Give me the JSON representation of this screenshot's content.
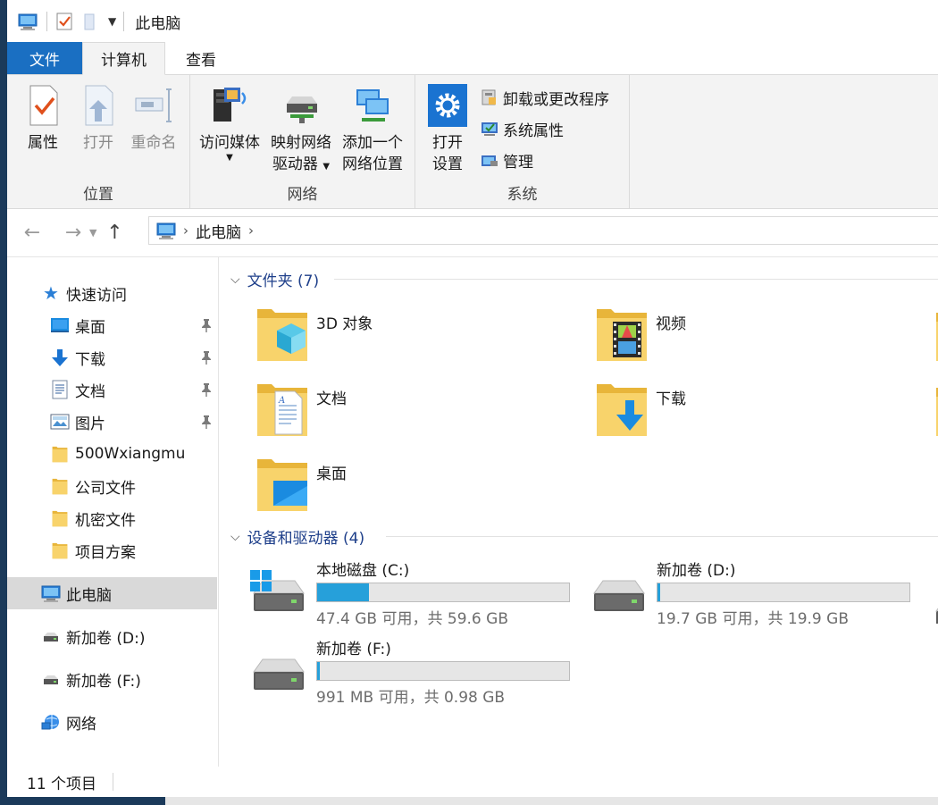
{
  "window": {
    "title": "此电脑"
  },
  "tabs": {
    "file": "文件",
    "computer": "计算机",
    "view": "查看"
  },
  "ribbon": {
    "location": {
      "label": "位置",
      "properties": "属性",
      "open": "打开",
      "rename": "重命名"
    },
    "network": {
      "label": "网络",
      "access_media": "访问媒体",
      "map_drive_1": "映射网络",
      "map_drive_2": "驱动器",
      "add_location_1": "添加一个",
      "add_location_2": "网络位置"
    },
    "system": {
      "label": "系统",
      "open_settings_1": "打开",
      "open_settings_2": "设置",
      "uninstall": "卸载或更改程序",
      "system_properties": "系统属性",
      "manage": "管理"
    }
  },
  "address": {
    "crumb": "此电脑"
  },
  "nav": {
    "quick_access": "快速访问",
    "items": [
      {
        "label": "桌面",
        "pinned": true
      },
      {
        "label": "下载",
        "pinned": true
      },
      {
        "label": "文档",
        "pinned": true
      },
      {
        "label": "图片",
        "pinned": true
      },
      {
        "label": "500Wxiangmu",
        "pinned": false
      },
      {
        "label": "公司文件",
        "pinned": false
      },
      {
        "label": "机密文件",
        "pinned": false
      },
      {
        "label": "项目方案",
        "pinned": false
      }
    ],
    "this_pc": "此电脑",
    "drive_d": "新加卷 (D:)",
    "drive_f": "新加卷 (F:)",
    "network": "网络"
  },
  "content": {
    "folders_header": "文件夹 (7)",
    "folders": [
      {
        "name": "3D 对象",
        "icon": "3d-objects-icon"
      },
      {
        "name": "视频",
        "icon": "videos-icon"
      },
      {
        "name": "文档",
        "icon": "documents-icon"
      },
      {
        "name": "下载",
        "icon": "downloads-icon"
      },
      {
        "name": "桌面",
        "icon": "desktop-icon"
      }
    ],
    "drives_header": "设备和驱动器 (4)",
    "drives": [
      {
        "name": "本地磁盘 (C:)",
        "free": "47.4 GB 可用，共 59.6 GB",
        "used_fraction": 0.205,
        "system": true
      },
      {
        "name": "新加卷 (D:)",
        "free": "19.7 GB 可用，共 19.9 GB",
        "used_fraction": 0.01,
        "system": false
      },
      {
        "name": "新加卷 (F:)",
        "free": "991 MB 可用，共 0.98 GB",
        "used_fraction": 0.01,
        "system": false
      }
    ]
  },
  "status": {
    "count": "11 个项目"
  },
  "colors": {
    "accent": "#1a6fc2",
    "progress": "#26a0da",
    "folder": "#f5c95a",
    "selected": "#d9d9d9"
  }
}
